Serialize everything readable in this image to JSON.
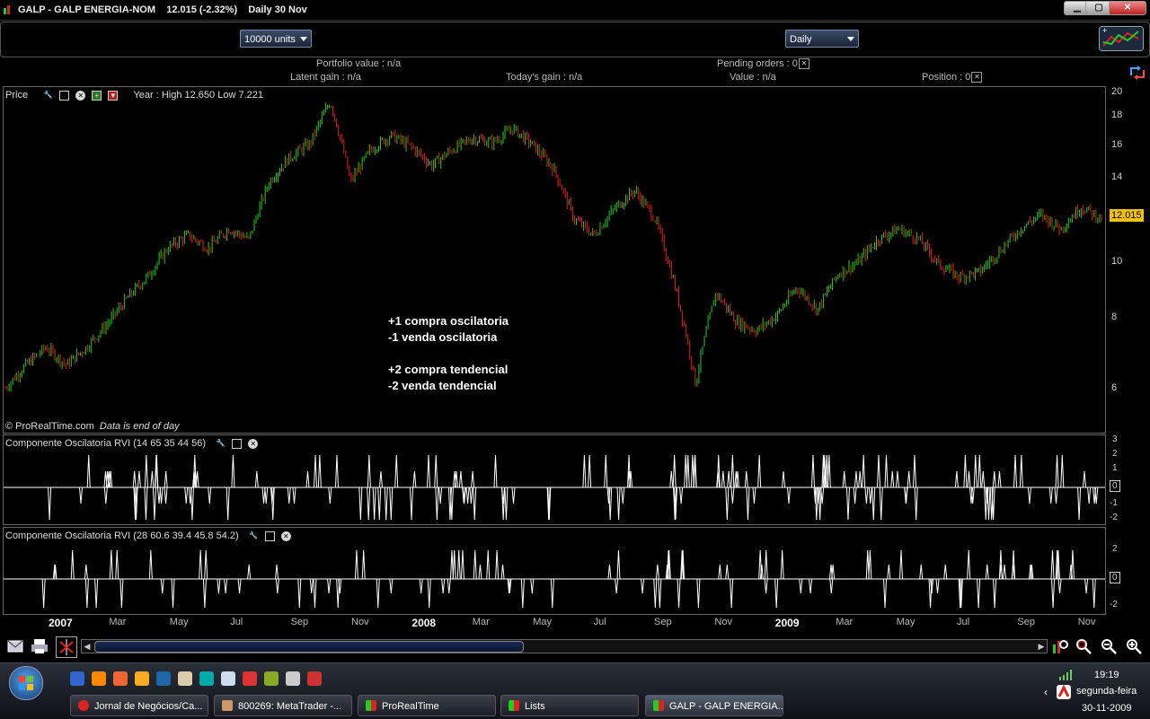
{
  "window": {
    "title": "GALP - GALP ENERGIA-NOM",
    "price": "12.015 (-2.32%)",
    "period": "Daily  30 Nov",
    "min": "▁",
    "max": "▢",
    "close": "✕"
  },
  "toolbar": {
    "units_label": "10000 units",
    "period_label": "Daily"
  },
  "account": {
    "portfolio_value": "Portfolio value : n/a",
    "pending_orders": "Pending orders : 0",
    "latent_gain": "Latent gain : n/a",
    "todays_gain": "Today's gain : n/a",
    "value": "Value : n/a",
    "position": "Position : 0"
  },
  "price_panel": {
    "name": "Price",
    "year_info": "Year : High 12.650 Low 7.221",
    "copyright": "© ProRealTime.com",
    "data_note": "Data is end of day",
    "last_price": "12.015",
    "yticks": [
      "20",
      "18",
      "16",
      "14",
      "10",
      "8",
      "6"
    ]
  },
  "annotations": [
    "+1 compra oscilatoria",
    "-1 venda oscilatoria",
    "+2 compra tendencial",
    "-2 venda tendencial"
  ],
  "osc1": {
    "name": "Componente Oscilatoria RVI (14 65 35 44 56)",
    "yticks": [
      "3",
      "2",
      "1",
      "0",
      "-1",
      "-2"
    ]
  },
  "osc2": {
    "name": "Componente Oscilatoria RVI (28 60.6 39.4 45.8 54.2)",
    "yticks": [
      "2",
      "0",
      "-2"
    ]
  },
  "xaxis": [
    {
      "label": "2007",
      "year": true
    },
    {
      "label": "Mar",
      "year": false
    },
    {
      "label": "May",
      "year": false
    },
    {
      "label": "Jul",
      "year": false
    },
    {
      "label": "Sep",
      "year": false
    },
    {
      "label": "Nov",
      "year": false
    },
    {
      "label": "2008",
      "year": true
    },
    {
      "label": "Mar",
      "year": false
    },
    {
      "label": "May",
      "year": false
    },
    {
      "label": "Jul",
      "year": false
    },
    {
      "label": "Sep",
      "year": false
    },
    {
      "label": "Nov",
      "year": false
    },
    {
      "label": "2009",
      "year": true
    },
    {
      "label": "Mar",
      "year": false
    },
    {
      "label": "May",
      "year": false
    },
    {
      "label": "Jul",
      "year": false
    },
    {
      "label": "Sep",
      "year": false
    },
    {
      "label": "Nov",
      "year": false
    }
  ],
  "chart_data": {
    "type": "line",
    "series": [
      {
        "values": [
          5.9,
          6.5,
          7.0,
          6.5,
          7.0,
          7.7,
          8.6,
          9.4,
          10.6,
          11.2,
          10.6,
          11.5,
          11.0,
          14.0,
          15.5,
          16.4,
          19.6,
          14.0,
          16.0,
          17.0,
          16.2,
          15.0,
          16.0,
          16.8,
          16.5,
          17.5,
          16.3,
          14.8,
          12.0,
          11.2,
          12.5,
          13.5,
          12.0,
          9.0,
          6.0,
          8.8,
          7.8,
          7.5,
          8.0,
          9.0,
          8.2,
          9.5,
          10.0,
          11.0,
          11.5,
          11.0,
          9.9,
          9.4,
          9.6,
          10.5,
          11.5,
          12.2,
          11.5,
          12.6,
          12.0
        ]
      }
    ],
    "ylim": [
      6,
      20
    ],
    "log_scale": true
  },
  "taskbar": {
    "items": [
      "Jornal de Negócios/Ca...",
      "800269: MetaTrader -...",
      "ProRealTime",
      "Lists",
      "GALP - GALP ENERGIA..."
    ],
    "time": "19:19",
    "day": "segunda-feira",
    "date": "30-11-2009"
  },
  "colors": {
    "up": "#22cc22",
    "down": "#dd2222",
    "accent": "#f2c200"
  }
}
